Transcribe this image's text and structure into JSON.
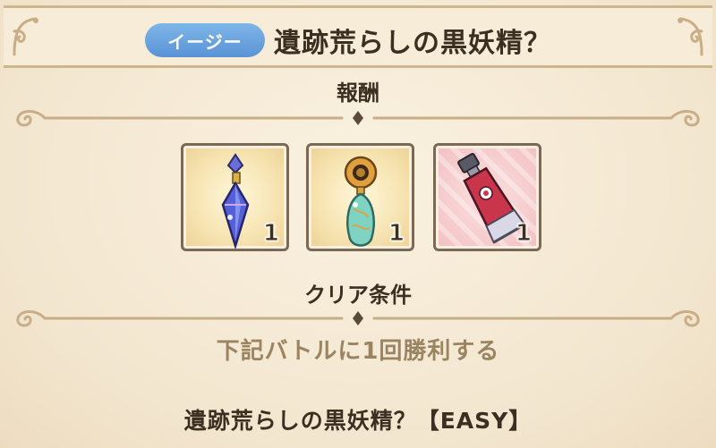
{
  "header": {
    "difficulty_badge": "イージー",
    "quest_title": "遺跡荒らしの黒妖精？"
  },
  "rewards_section": {
    "label": "報酬",
    "items": [
      {
        "icon": "blue-crystal-bottle-icon",
        "quantity": "1",
        "frame": "gold"
      },
      {
        "icon": "teal-amulet-icon",
        "quantity": "1",
        "frame": "gold"
      },
      {
        "icon": "paint-tube-icon",
        "quantity": "1",
        "frame": "pink"
      }
    ]
  },
  "clear_conditions": {
    "label": "クリア条件",
    "condition": "下記バトルに1回勝利する",
    "battle": "遺跡荒らしの黒妖精？【EASY】"
  },
  "colors": {
    "badge": "#6aa3de",
    "title_text": "#3b2f22",
    "condition_text": "#9b8462",
    "ornament": "#c7ae86"
  }
}
